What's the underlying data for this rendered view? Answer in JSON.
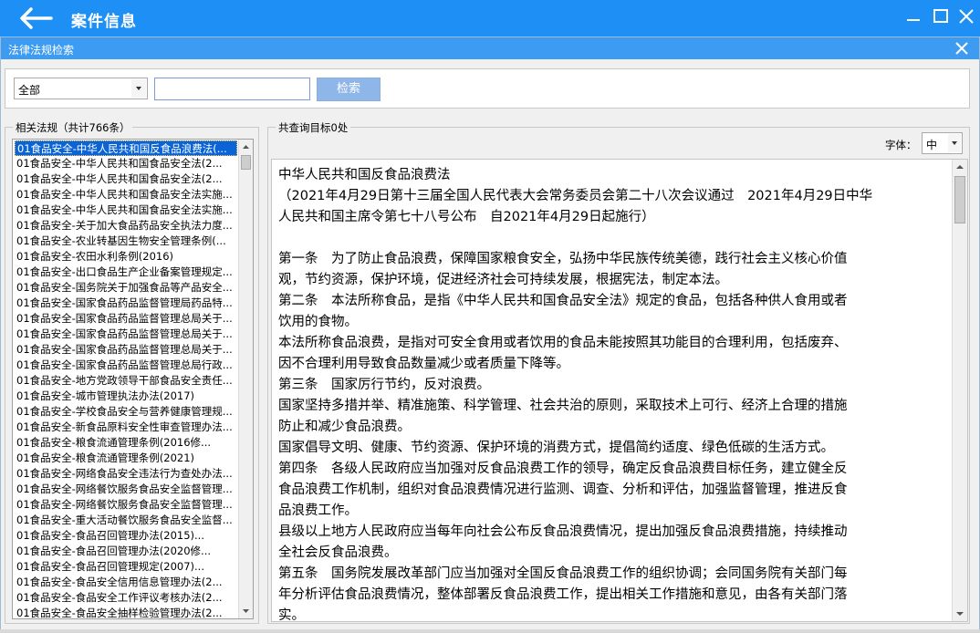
{
  "window": {
    "title": "案件信息"
  },
  "dialog": {
    "title": "法律法规检索"
  },
  "search": {
    "category_value": "全部",
    "input_value": "",
    "button_label": "检索"
  },
  "law_list": {
    "legend": "相关法规（共计766条）",
    "selected_index": 0,
    "items": [
      "01食品安全-中华人民共和国反食品浪费法(...",
      "01食品安全-中华人民共和国食品安全法(2...",
      "01食品安全-中华人民共和国食品安全法(2...",
      "01食品安全-中华人民共和国食品安全法实施...",
      "01食品安全-中华人民共和国食品安全法实施...",
      "01食品安全-关于加大食品药品安全执法力度...",
      "01食品安全-农业转基因生物安全管理条例(...",
      "01食品安全-农田水利条例(2016)",
      "01食品安全-出口食品生产企业备案管理规定...",
      "01食品安全-国务院关于加强食品等产品安全...",
      "01食品安全-国家食品药品监督管理局药品特...",
      "01食品安全-国家食品药品监督管理总局关于...",
      "01食品安全-国家食品药品监督管理总局关于...",
      "01食品安全-国家食品药品监督管理总局关于...",
      "01食品安全-国家食品药品监督管理总局行政...",
      "01食品安全-地方党政领导干部食品安全责任...",
      "01食品安全-城市管理执法办法(2017)",
      "01食品安全-学校食品安全与营养健康管理规...",
      "01食品安全-新食品原料安全性审查管理办法...",
      "01食品安全-粮食流通管理条例(2016修...",
      "01食品安全-粮食流通管理条例(2021)",
      "01食品安全-网络食品安全违法行为查处办法...",
      "01食品安全-网络餐饮服务食品安全监督管理...",
      "01食品安全-网络餐饮服务食品安全监督管理...",
      "01食品安全-重大活动餐饮服务食品安全监督...",
      "01食品安全-食品召回管理办法(2015)...",
      "01食品安全-食品召回管理办法(2020修...",
      "01食品安全-食品召回管理规定(2007)...",
      "01食品安全-食品安全信用信息管理办法(2...",
      "01食品安全-食品安全工作评议考核办法(2...",
      "01食品安全-食品安全抽样检验管理办法(2..."
    ]
  },
  "result": {
    "legend": "共查询目标0处",
    "font_label": "字体：",
    "font_value": "中",
    "lines": [
      "中华人民共和国反食品浪费法",
      "（2021年4月29日第十三届全国人民代表大会常务委员会第二十八次会议通过　2021年4月29日中华",
      "人民共和国主席令第七十八号公布　自2021年4月29日起施行）",
      "",
      "第一条　为了防止食品浪费，保障国家粮食安全，弘扬中华民族传统美德，践行社会主义核心价值",
      "观，节约资源，保护环境，促进经济社会可持续发展，根据宪法，制定本法。",
      "第二条　本法所称食品，是指《中华人民共和国食品安全法》规定的食品，包括各种供人食用或者",
      "饮用的食物。",
      "本法所称食品浪费，是指对可安全食用或者饮用的食品未能按照其功能目的合理利用，包括废弃、",
      "因不合理利用导致食品数量减少或者质量下降等。",
      "第三条　国家厉行节约，反对浪费。",
      "国家坚持多措并举、精准施策、科学管理、社会共治的原则，采取技术上可行、经济上合理的措施",
      "防止和减少食品浪费。",
      "国家倡导文明、健康、节约资源、保护环境的消费方式，提倡简约适度、绿色低碳的生活方式。",
      "第四条　各级人民政府应当加强对反食品浪费工作的领导，确定反食品浪费目标任务，建立健全反",
      "食品浪费工作机制，组织对食品浪费情况进行监测、调查、分析和评估，加强监督管理，推进反食",
      "品浪费工作。",
      "县级以上地方人民政府应当每年向社会公布反食品浪费情况，提出加强反食品浪费措施，持续推动",
      "全社会反食品浪费。",
      "第五条　国务院发展改革部门应当加强对全国反食品浪费工作的组织协调；会同国务院有关部门每",
      "年分析评估食品浪费情况，整体部署反食品浪费工作，提出相关工作措施和意见，由各有关部门落",
      "实。"
    ]
  },
  "icons": {
    "back": "back-arrow-icon",
    "minimize": "minimize-icon",
    "maximize": "maximize-icon",
    "close": "close-icon"
  },
  "colors": {
    "titlebar": "#1d8ff5",
    "dialog_titlebar": "#3d9cf2",
    "search_button": "#8fb6e8",
    "selection": "#0a64d6"
  }
}
